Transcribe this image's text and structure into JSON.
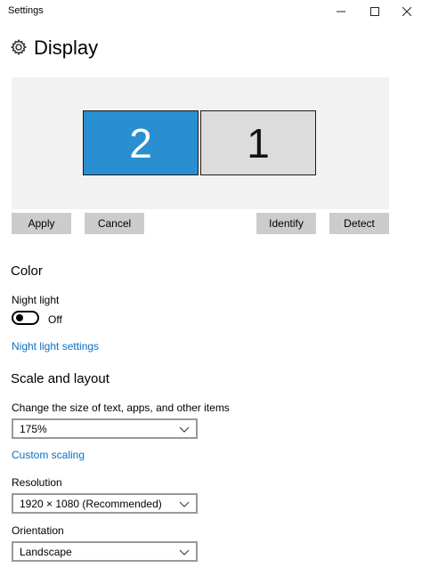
{
  "window": {
    "title": "Settings",
    "minimize_glyph": "─",
    "maximize_glyph": "☐",
    "close_glyph": "✕"
  },
  "header": {
    "title": "Display",
    "icon": "gear-icon"
  },
  "monitors": {
    "left_label": "2",
    "right_label": "1",
    "selected": "2",
    "selected_color": "#2a8fd1"
  },
  "actions": {
    "apply": "Apply",
    "cancel": "Cancel",
    "identify": "Identify",
    "detect": "Detect"
  },
  "color_section": {
    "title": "Color",
    "night_light_label": "Night light",
    "night_light_state": "Off",
    "night_light_settings_link": "Night light settings"
  },
  "scale_section": {
    "title": "Scale and layout",
    "size_label": "Change the size of text, apps, and other items",
    "size_value": "175%",
    "custom_scaling_link": "Custom scaling",
    "resolution_label": "Resolution",
    "resolution_value": "1920 × 1080 (Recommended)",
    "orientation_label": "Orientation",
    "orientation_value": "Landscape"
  },
  "colors": {
    "accent": "#2a8fd1",
    "link": "#0b6fc0",
    "button_bg": "#cccccc"
  }
}
